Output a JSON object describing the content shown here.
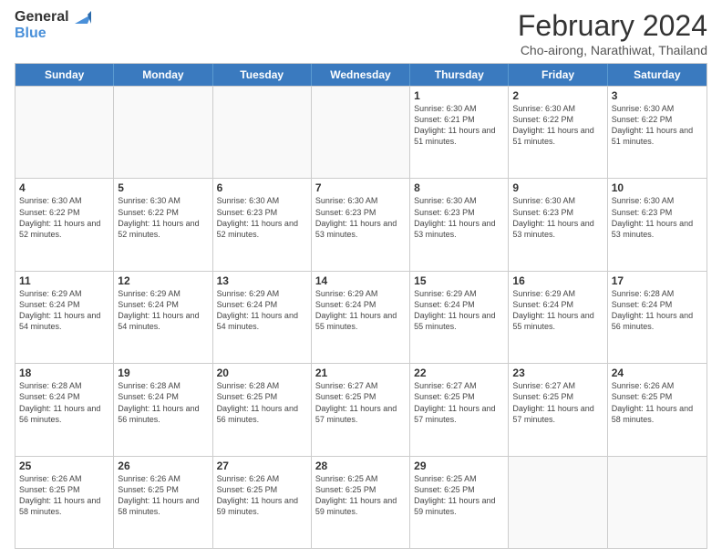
{
  "logo": {
    "line1": "General",
    "line2": "Blue"
  },
  "title": "February 2024",
  "subtitle": "Cho-airong, Narathiwat, Thailand",
  "weekdays": [
    "Sunday",
    "Monday",
    "Tuesday",
    "Wednesday",
    "Thursday",
    "Friday",
    "Saturday"
  ],
  "weeks": [
    [
      {
        "day": "",
        "info": ""
      },
      {
        "day": "",
        "info": ""
      },
      {
        "day": "",
        "info": ""
      },
      {
        "day": "",
        "info": ""
      },
      {
        "day": "1",
        "info": "Sunrise: 6:30 AM\nSunset: 6:21 PM\nDaylight: 11 hours and 51 minutes."
      },
      {
        "day": "2",
        "info": "Sunrise: 6:30 AM\nSunset: 6:22 PM\nDaylight: 11 hours and 51 minutes."
      },
      {
        "day": "3",
        "info": "Sunrise: 6:30 AM\nSunset: 6:22 PM\nDaylight: 11 hours and 51 minutes."
      }
    ],
    [
      {
        "day": "4",
        "info": "Sunrise: 6:30 AM\nSunset: 6:22 PM\nDaylight: 11 hours and 52 minutes."
      },
      {
        "day": "5",
        "info": "Sunrise: 6:30 AM\nSunset: 6:22 PM\nDaylight: 11 hours and 52 minutes."
      },
      {
        "day": "6",
        "info": "Sunrise: 6:30 AM\nSunset: 6:23 PM\nDaylight: 11 hours and 52 minutes."
      },
      {
        "day": "7",
        "info": "Sunrise: 6:30 AM\nSunset: 6:23 PM\nDaylight: 11 hours and 53 minutes."
      },
      {
        "day": "8",
        "info": "Sunrise: 6:30 AM\nSunset: 6:23 PM\nDaylight: 11 hours and 53 minutes."
      },
      {
        "day": "9",
        "info": "Sunrise: 6:30 AM\nSunset: 6:23 PM\nDaylight: 11 hours and 53 minutes."
      },
      {
        "day": "10",
        "info": "Sunrise: 6:30 AM\nSunset: 6:23 PM\nDaylight: 11 hours and 53 minutes."
      }
    ],
    [
      {
        "day": "11",
        "info": "Sunrise: 6:29 AM\nSunset: 6:24 PM\nDaylight: 11 hours and 54 minutes."
      },
      {
        "day": "12",
        "info": "Sunrise: 6:29 AM\nSunset: 6:24 PM\nDaylight: 11 hours and 54 minutes."
      },
      {
        "day": "13",
        "info": "Sunrise: 6:29 AM\nSunset: 6:24 PM\nDaylight: 11 hours and 54 minutes."
      },
      {
        "day": "14",
        "info": "Sunrise: 6:29 AM\nSunset: 6:24 PM\nDaylight: 11 hours and 55 minutes."
      },
      {
        "day": "15",
        "info": "Sunrise: 6:29 AM\nSunset: 6:24 PM\nDaylight: 11 hours and 55 minutes."
      },
      {
        "day": "16",
        "info": "Sunrise: 6:29 AM\nSunset: 6:24 PM\nDaylight: 11 hours and 55 minutes."
      },
      {
        "day": "17",
        "info": "Sunrise: 6:28 AM\nSunset: 6:24 PM\nDaylight: 11 hours and 56 minutes."
      }
    ],
    [
      {
        "day": "18",
        "info": "Sunrise: 6:28 AM\nSunset: 6:24 PM\nDaylight: 11 hours and 56 minutes."
      },
      {
        "day": "19",
        "info": "Sunrise: 6:28 AM\nSunset: 6:24 PM\nDaylight: 11 hours and 56 minutes."
      },
      {
        "day": "20",
        "info": "Sunrise: 6:28 AM\nSunset: 6:25 PM\nDaylight: 11 hours and 56 minutes."
      },
      {
        "day": "21",
        "info": "Sunrise: 6:27 AM\nSunset: 6:25 PM\nDaylight: 11 hours and 57 minutes."
      },
      {
        "day": "22",
        "info": "Sunrise: 6:27 AM\nSunset: 6:25 PM\nDaylight: 11 hours and 57 minutes."
      },
      {
        "day": "23",
        "info": "Sunrise: 6:27 AM\nSunset: 6:25 PM\nDaylight: 11 hours and 57 minutes."
      },
      {
        "day": "24",
        "info": "Sunrise: 6:26 AM\nSunset: 6:25 PM\nDaylight: 11 hours and 58 minutes."
      }
    ],
    [
      {
        "day": "25",
        "info": "Sunrise: 6:26 AM\nSunset: 6:25 PM\nDaylight: 11 hours and 58 minutes."
      },
      {
        "day": "26",
        "info": "Sunrise: 6:26 AM\nSunset: 6:25 PM\nDaylight: 11 hours and 58 minutes."
      },
      {
        "day": "27",
        "info": "Sunrise: 6:26 AM\nSunset: 6:25 PM\nDaylight: 11 hours and 59 minutes."
      },
      {
        "day": "28",
        "info": "Sunrise: 6:25 AM\nSunset: 6:25 PM\nDaylight: 11 hours and 59 minutes."
      },
      {
        "day": "29",
        "info": "Sunrise: 6:25 AM\nSunset: 6:25 PM\nDaylight: 11 hours and 59 minutes."
      },
      {
        "day": "",
        "info": ""
      },
      {
        "day": "",
        "info": ""
      }
    ]
  ]
}
